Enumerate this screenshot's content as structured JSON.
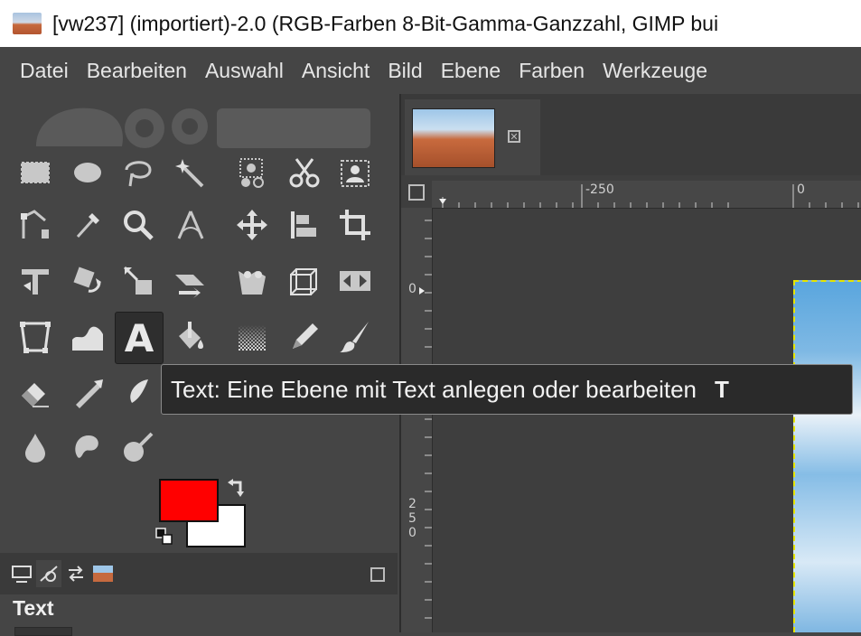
{
  "window": {
    "title": "[vw237] (importiert)-2.0 (RGB-Farben 8-Bit-Gamma-Ganzzahl, GIMP bui",
    "app_icon": "gimp-image-icon"
  },
  "menubar": {
    "items": [
      "Datei",
      "Bearbeiten",
      "Auswahl",
      "Ansicht",
      "Bild",
      "Ebene",
      "Farben",
      "Werkzeuge"
    ]
  },
  "toolbox": {
    "tools": [
      {
        "name": "rect-select-icon",
        "active": false
      },
      {
        "name": "ellipse-select-icon",
        "active": false
      },
      {
        "name": "free-select-icon",
        "active": false
      },
      {
        "name": "fuzzy-select-icon",
        "active": false
      },
      {
        "name": "select-by-color-icon",
        "active": false
      },
      {
        "name": "scissors-select-icon",
        "active": false
      },
      {
        "name": "foreground-select-icon",
        "active": false
      },
      {
        "name": "paths-icon",
        "active": false
      },
      {
        "name": "color-picker-icon",
        "active": false
      },
      {
        "name": "zoom-icon",
        "active": false
      },
      {
        "name": "measure-icon",
        "active": false
      },
      {
        "name": "move-icon",
        "active": false
      },
      {
        "name": "align-icon",
        "active": false
      },
      {
        "name": "crop-icon",
        "active": false
      },
      {
        "name": "unified-transform-icon",
        "active": false
      },
      {
        "name": "rotate-icon",
        "active": false
      },
      {
        "name": "scale-icon",
        "active": false
      },
      {
        "name": "shear-icon",
        "active": false
      },
      {
        "name": "perspective-icon",
        "active": false
      },
      {
        "name": "3d-transform-icon",
        "active": false
      },
      {
        "name": "flip-icon",
        "active": false
      },
      {
        "name": "cage-transform-icon",
        "active": false
      },
      {
        "name": "warp-transform-icon",
        "active": false
      },
      {
        "name": "text-tool-icon",
        "active": true
      },
      {
        "name": "bucket-fill-icon",
        "active": false
      },
      {
        "name": "gradient-icon",
        "active": false
      },
      {
        "name": "pencil-icon",
        "active": false
      },
      {
        "name": "paintbrush-icon",
        "active": false
      },
      {
        "name": "eraser-icon",
        "active": false
      },
      {
        "name": "airbrush-icon",
        "active": false
      },
      {
        "name": "ink-icon",
        "active": false
      },
      {
        "name": "blur-icon",
        "active": false
      },
      {
        "name": "smudge-icon",
        "active": false
      },
      {
        "name": "dodge-burn-icon",
        "active": false
      }
    ],
    "text_tool_letter": "A",
    "fg_color": "#ff0000",
    "bg_color": "#ffffff"
  },
  "tooltip": {
    "text": "Text: Eine Ebene mit Text anlegen oder bearbeiten",
    "shortcut": "T"
  },
  "dock": {
    "tabs": [
      "tool-options-icon",
      "paint-dynamics-icon",
      "undo-history-icon",
      "images-icon"
    ],
    "options_title": "Text"
  },
  "canvas": {
    "ruler_h_labels": [
      "-250",
      "0"
    ],
    "ruler_v_labels": [
      "0",
      "2",
      "5",
      "0"
    ]
  }
}
